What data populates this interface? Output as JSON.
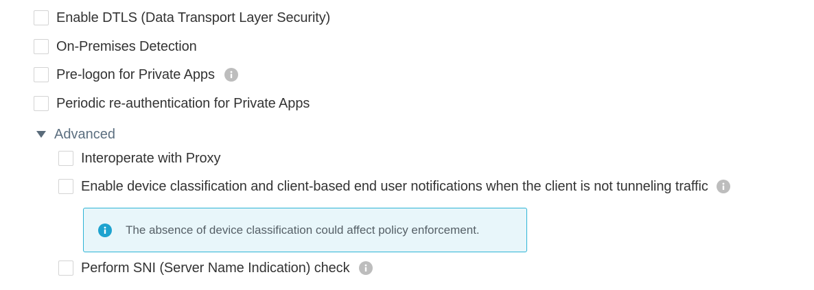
{
  "options": [
    {
      "label": "Enable DTLS (Data Transport Layer Security)",
      "checked": false,
      "has_info": false
    },
    {
      "label": "On-Premises Detection",
      "checked": false,
      "has_info": false
    },
    {
      "label": "Pre-logon for Private Apps",
      "checked": false,
      "has_info": true
    },
    {
      "label": "Periodic re-authentication for Private Apps",
      "checked": false,
      "has_info": false
    }
  ],
  "advanced": {
    "label": "Advanced",
    "expanded": true,
    "options": [
      {
        "label": "Interoperate with Proxy",
        "checked": false,
        "has_info": false
      },
      {
        "label": "Enable device classification and client-based end user notifications when the client is not tunneling traffic",
        "checked": false,
        "has_info": true
      },
      {
        "label": "Perform SNI (Server Name Indication) check",
        "checked": false,
        "has_info": true
      }
    ],
    "note": {
      "icon": "info-icon",
      "text": "The absence of device classification could affect policy enforcement."
    }
  },
  "colors": {
    "checkbox_border": "#d3d3d3",
    "info_icon_gray": "#bdbdbd",
    "note_border": "#2bb3d6",
    "note_background": "#e8f6fa",
    "note_icon": "#1ea3cf",
    "advanced_text": "#5b6e7f"
  }
}
